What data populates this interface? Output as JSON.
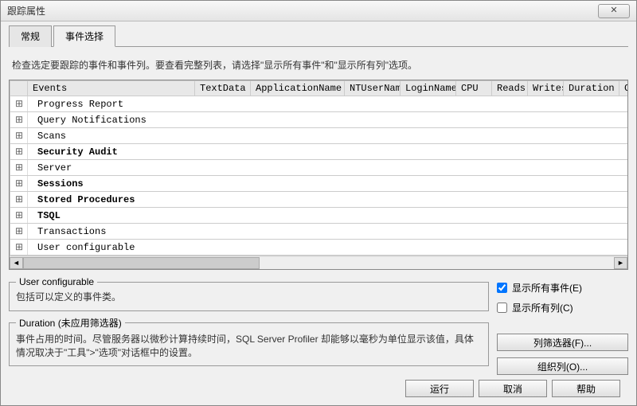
{
  "window": {
    "title": "跟踪属性",
    "closeGlyph": "✕"
  },
  "tabs": {
    "general": "常规",
    "events": "事件选择"
  },
  "instruction": "检查选定要跟踪的事件和事件列。要查看完整列表，请选择\"显示所有事件\"和\"显示所有列\"选项。",
  "columns": {
    "events": "Events",
    "textData": "TextData",
    "appName": "ApplicationName",
    "ntUser": "NTUserName",
    "login": "LoginName",
    "cpu": "CPU",
    "reads": "Reads",
    "writes": "Writes",
    "duration": "Duration",
    "clientP": "ClientP"
  },
  "rows": [
    {
      "name": "Progress Report",
      "bold": false
    },
    {
      "name": "Query Notifications",
      "bold": false
    },
    {
      "name": "Scans",
      "bold": false
    },
    {
      "name": "Security Audit",
      "bold": true
    },
    {
      "name": "Server",
      "bold": false
    },
    {
      "name": "Sessions",
      "bold": true
    },
    {
      "name": "Stored Procedures",
      "bold": true
    },
    {
      "name": "TSQL",
      "bold": true
    },
    {
      "name": "Transactions",
      "bold": false
    },
    {
      "name": "User configurable",
      "bold": false
    }
  ],
  "groupbox1": {
    "legend": "User configurable",
    "desc": "包括可以定义的事件类。"
  },
  "groupbox2": {
    "legend": "Duration (未应用筛选器)",
    "desc": "事件占用的时间。尽管服务器以微秒计算持续时间，SQL Server Profiler 却能够以毫秒为单位显示该值，具体情况取决于\"工具\">\"选项\"对话框中的设置。"
  },
  "checkboxes": {
    "showAllEvents": "显示所有事件(E)",
    "showAllColumns": "显示所有列(C)"
  },
  "buttons": {
    "columnFilter": "列筛选器(F)...",
    "organizeColumns": "组织列(O)...",
    "run": "运行",
    "cancel": "取消",
    "help": "帮助"
  },
  "icons": {
    "expand": "⊞"
  }
}
